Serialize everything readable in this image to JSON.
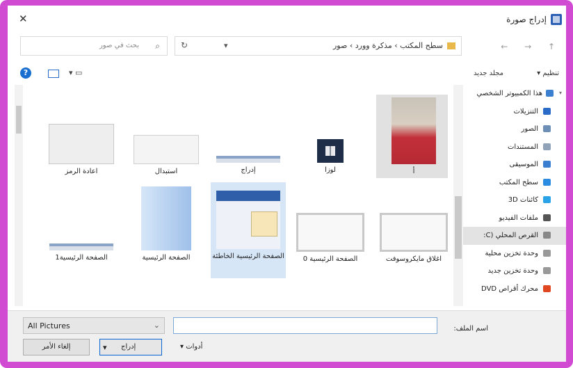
{
  "window": {
    "title": "إدراج صورة",
    "close_glyph": "✕"
  },
  "nav": {
    "arrows": "← → ↑",
    "dropdown_glyph": "▾",
    "refresh_glyph": "↻"
  },
  "address": {
    "breadcrumb": "سطح المكتب  ›  مذكرة وورد  ›  صور"
  },
  "search": {
    "placeholder": "بحث في صور",
    "icon": "search-icon"
  },
  "toolbar": {
    "organize": "تنظيم ▾",
    "new_folder": "مجلد جديد",
    "help": "?",
    "views_glyph": "▾ ▭"
  },
  "sidebar": {
    "items": [
      {
        "label": "هذا الكمبيوتر الشخصي",
        "icon": "computer-icon",
        "color": "#3a7fd0",
        "root": true
      },
      {
        "label": "التنزيلات",
        "icon": "download-icon",
        "color": "#2a6bc7"
      },
      {
        "label": "الصور",
        "icon": "pictures-icon",
        "color": "#6d8fb5"
      },
      {
        "label": "المستندات",
        "icon": "documents-icon",
        "color": "#8fa2b8"
      },
      {
        "label": "الموسيقى",
        "icon": "music-icon",
        "color": "#3a7fd0"
      },
      {
        "label": "سطح المكتب",
        "icon": "desktop-icon",
        "color": "#2a8ce0"
      },
      {
        "label": "كائنات 3D",
        "icon": "3d-objects-icon",
        "color": "#2aa3e8"
      },
      {
        "label": "ملفات الفيديو",
        "icon": "video-icon",
        "color": "#555555"
      },
      {
        "label": "القرص المحلي (C:",
        "icon": "drive-icon",
        "color": "#888888",
        "selected": true
      },
      {
        "label": "وحدة تخزين محلية",
        "icon": "drive-icon",
        "color": "#999999"
      },
      {
        "label": "وحدة تخزين جديد",
        "icon": "drive-icon",
        "color": "#999999"
      },
      {
        "label": "محرك أقراص DVD",
        "icon": "dvd-drive-icon",
        "color": "#e0461f"
      }
    ]
  },
  "files": [
    {
      "label": "أ",
      "kind": "photo"
    },
    {
      "label": "لوزا",
      "kind": "app"
    },
    {
      "label": "إدراج",
      "kind": "strip"
    },
    {
      "label": "استبدال",
      "kind": "dialog"
    },
    {
      "label": "اعادة الرمز",
      "kind": "dialog2"
    },
    {
      "label": "اغلاق مايكروسوفت",
      "kind": "window"
    },
    {
      "label": "الصفحة الرئيسية 0",
      "kind": "window"
    },
    {
      "label": "الصفحة الرئيسية الخاطئة",
      "kind": "menu",
      "selected": true
    },
    {
      "label": "الصفحة الرئيسية",
      "kind": "gradient"
    },
    {
      "label": "الصفحة الرئيسية1",
      "kind": "strip"
    }
  ],
  "bottom": {
    "filename_label": "اسم الملف:",
    "filename_value": "",
    "filetype_value": "All Pictures",
    "tools": "أدوات  ▾",
    "insert": "إدراج",
    "cancel": "إلغاء الأمر"
  },
  "colors": {
    "frame": "#d04bd2",
    "accent": "#0a64d4",
    "selection": "#d6e6f7"
  }
}
